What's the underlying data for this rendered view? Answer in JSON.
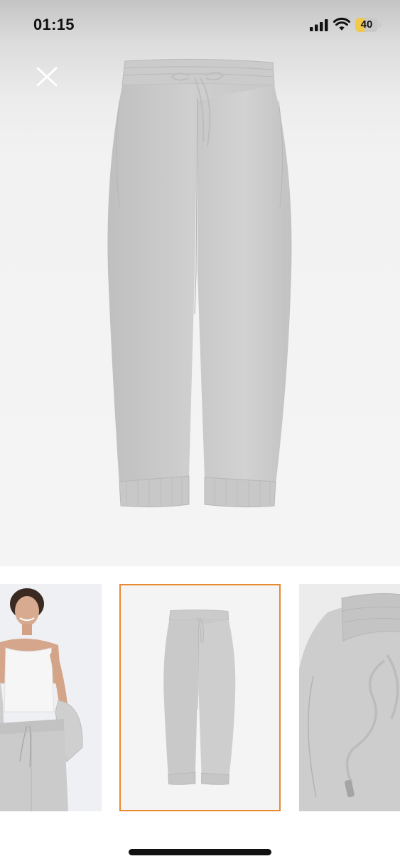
{
  "status_bar": {
    "time": "01:15",
    "battery_level": "40",
    "battery_fraction": 0.4,
    "icons": [
      "cellular-signal-icon",
      "wifi-icon",
      "battery-icon"
    ]
  },
  "toolbar": {
    "close_icon": "close-icon"
  },
  "gallery": {
    "selected_index": 1,
    "thumbnails": [
      {
        "name": "model-wearing-set"
      },
      {
        "name": "product-flat-lay"
      },
      {
        "name": "drawstring-detail"
      }
    ]
  },
  "colors": {
    "selected_outline": "#e8892f",
    "product_grey": "#cdcdcd"
  }
}
